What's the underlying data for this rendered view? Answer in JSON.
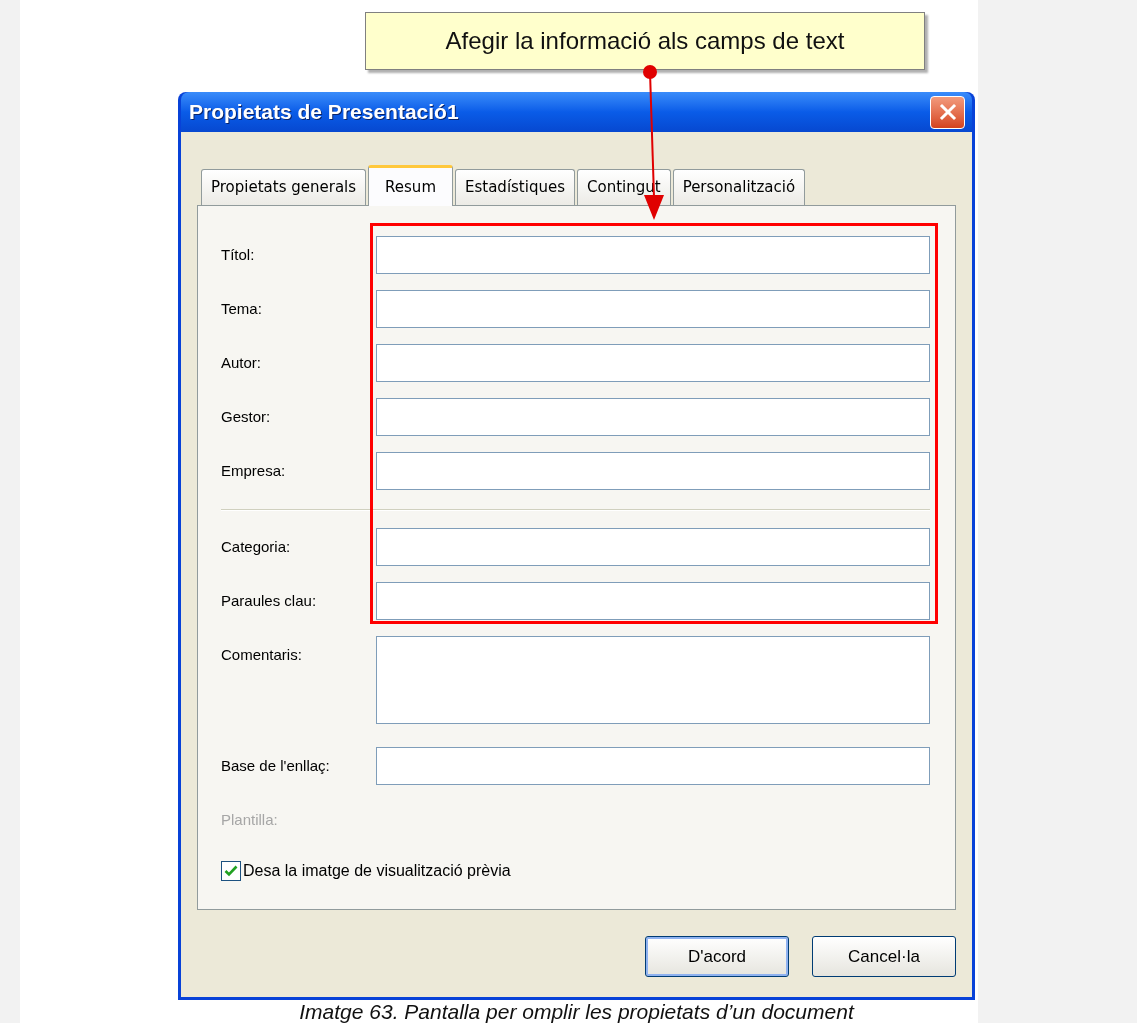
{
  "callout": {
    "text": "Afegir la informació als camps de text"
  },
  "dialog": {
    "title": "Propietats de Presentació1",
    "tabs": [
      {
        "label": "Propietats generals",
        "selected": false
      },
      {
        "label": "Resum",
        "selected": true
      },
      {
        "label": "Estadístiques",
        "selected": false
      },
      {
        "label": "Contingut",
        "selected": false
      },
      {
        "label": "Personalització",
        "selected": false
      }
    ],
    "sections": [
      {
        "highlighted": true,
        "divider_above": false,
        "fields": [
          {
            "label": "Títol:",
            "kind": "text",
            "disabled": false
          },
          {
            "label": "Tema:",
            "kind": "text",
            "disabled": false
          },
          {
            "label": "Autor:",
            "kind": "text",
            "disabled": false
          },
          {
            "label": "Gestor:",
            "kind": "text",
            "disabled": false
          },
          {
            "label": "Empresa:",
            "kind": "text",
            "disabled": false
          }
        ]
      },
      {
        "highlighted": true,
        "divider_above": true,
        "fields": [
          {
            "label": "Categoria:",
            "kind": "text",
            "disabled": false
          },
          {
            "label": "Paraules clau:",
            "kind": "text",
            "disabled": false
          }
        ]
      },
      {
        "highlighted": false,
        "divider_above": false,
        "fields": [
          {
            "label": "Comentaris:",
            "kind": "multiline",
            "disabled": false
          },
          {
            "label": "Base de l'enllaç:",
            "kind": "text",
            "disabled": false
          },
          {
            "label": "Plantilla:",
            "kind": "static",
            "disabled": true
          }
        ]
      }
    ],
    "checkbox": {
      "label": "Desa la imatge de visualització prèvia",
      "checked": true
    },
    "buttons": [
      {
        "label": "D'acord",
        "default": true
      },
      {
        "label": "Cancel·la",
        "default": false
      }
    ]
  },
  "caption": "Imatge 63. Pantalla per omplir les propietats d’un document"
}
